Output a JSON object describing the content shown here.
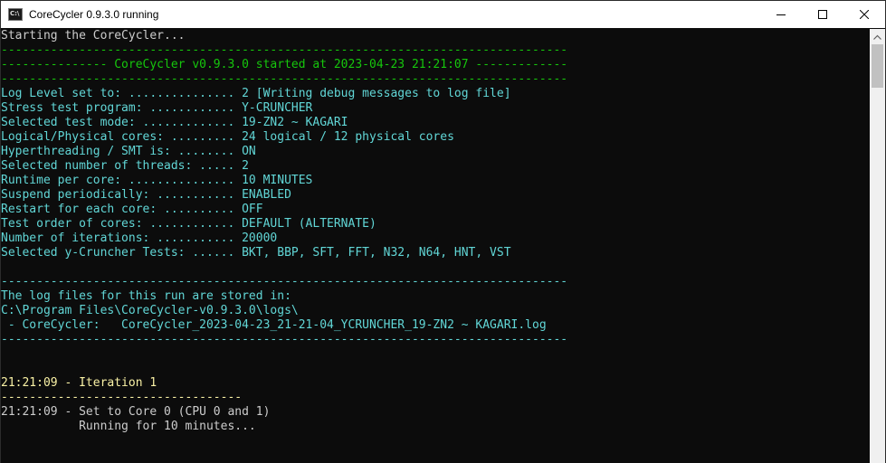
{
  "window": {
    "title": "CoreCycler 0.9.3.0 running"
  },
  "console": {
    "lines": [
      {
        "text": "Starting the CoreCycler...",
        "color": "white"
      },
      {
        "text": "--------------------------------------------------------------------------------",
        "color": "green"
      },
      {
        "text": "--------------- CoreCycler v0.9.3.0 started at 2023-04-23 21:21:07 -------------",
        "color": "green"
      },
      {
        "text": "--------------------------------------------------------------------------------",
        "color": "green"
      },
      {
        "text": "Log Level set to: ............... 2 [Writing debug messages to log file]",
        "color": "cyan"
      },
      {
        "text": "Stress test program: ............ Y-CRUNCHER",
        "color": "cyan"
      },
      {
        "text": "Selected test mode: ............. 19-ZN2 ~ KAGARI",
        "color": "cyan"
      },
      {
        "text": "Logical/Physical cores: ......... 24 logical / 12 physical cores",
        "color": "cyan"
      },
      {
        "text": "Hyperthreading / SMT is: ........ ON",
        "color": "cyan"
      },
      {
        "text": "Selected number of threads: ..... 2",
        "color": "cyan"
      },
      {
        "text": "Runtime per core: ............... 10 MINUTES",
        "color": "cyan"
      },
      {
        "text": "Suspend periodically: ........... ENABLED",
        "color": "cyan"
      },
      {
        "text": "Restart for each core: .......... OFF",
        "color": "cyan"
      },
      {
        "text": "Test order of cores: ............ DEFAULT (ALTERNATE)",
        "color": "cyan"
      },
      {
        "text": "Number of iterations: ........... 20000",
        "color": "cyan"
      },
      {
        "text": "Selected y-Cruncher Tests: ...... BKT, BBP, SFT, FFT, N32, N64, HNT, VST",
        "color": "cyan"
      },
      {
        "text": "",
        "color": "cyan"
      },
      {
        "text": "--------------------------------------------------------------------------------",
        "color": "cyan"
      },
      {
        "text": "The log files for this run are stored in:",
        "color": "cyan"
      },
      {
        "text": "C:\\Program Files\\CoreCycler-v0.9.3.0\\logs\\",
        "color": "cyan"
      },
      {
        "text": " - CoreCycler:   CoreCycler_2023-04-23_21-21-04_YCRUNCHER_19-ZN2 ~ KAGARI.log",
        "color": "cyan"
      },
      {
        "text": "--------------------------------------------------------------------------------",
        "color": "cyan"
      },
      {
        "text": "",
        "color": "white"
      },
      {
        "text": "",
        "color": "white"
      },
      {
        "text": "21:21:09 - Iteration 1",
        "color": "yellow"
      },
      {
        "text": "----------------------------------",
        "color": "yellow"
      },
      {
        "text": "21:21:09 - Set to Core 0 (CPU 0 and 1)",
        "color": "white"
      },
      {
        "text": "           Running for 10 minutes...",
        "color": "white"
      }
    ]
  },
  "colors": {
    "white": "#cccccc",
    "green": "#16c60c",
    "cyan": "#61d6d6",
    "yellow": "#f9f1a5",
    "background": "#0c0c0c"
  },
  "icons": {
    "app": "console-icon",
    "minimize": "minimize-icon",
    "maximize": "maximize-icon",
    "close": "close-icon"
  }
}
